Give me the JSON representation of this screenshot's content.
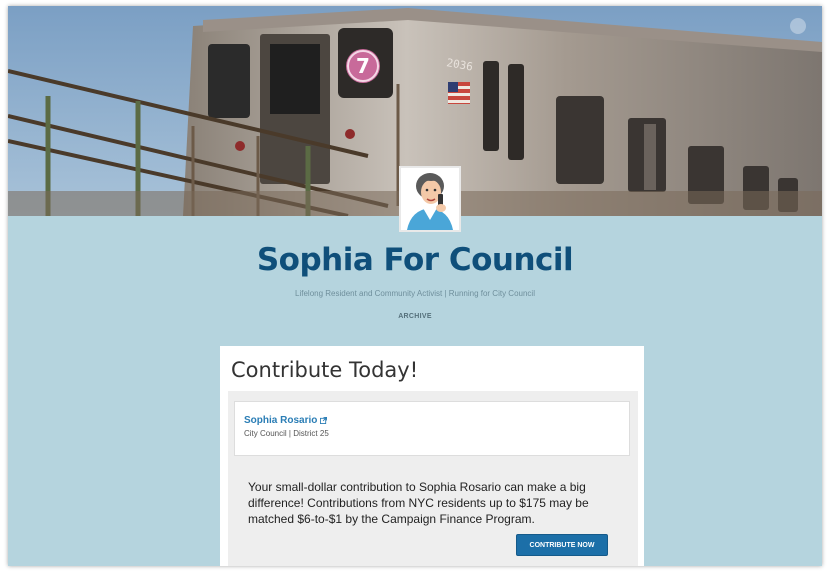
{
  "site": {
    "title": "Sophia For Council",
    "description": "Lifelong Resident and Community Activist | Running for City Council",
    "nav": {
      "archive_label": "ARCHIVE"
    }
  },
  "banner": {
    "train_route": "7",
    "car_number": "2036"
  },
  "content": {
    "heading": "Contribute Today!",
    "widget": {
      "candidate_name": "Sophia Rosario",
      "candidate_office": "City Council | District 25",
      "body_text": "Your small-dollar contribution to Sophia Rosario can make a big difference! Contributions from NYC residents up to $175 may be matched $6-to-$1 by the Campaign Finance Program.",
      "button_label": "CONTRIBUTE NOW"
    }
  },
  "colors": {
    "page_background": "#b5d4de",
    "title": "#0f4f7a",
    "link": "#2a7db5",
    "button": "#1c6fa8"
  }
}
